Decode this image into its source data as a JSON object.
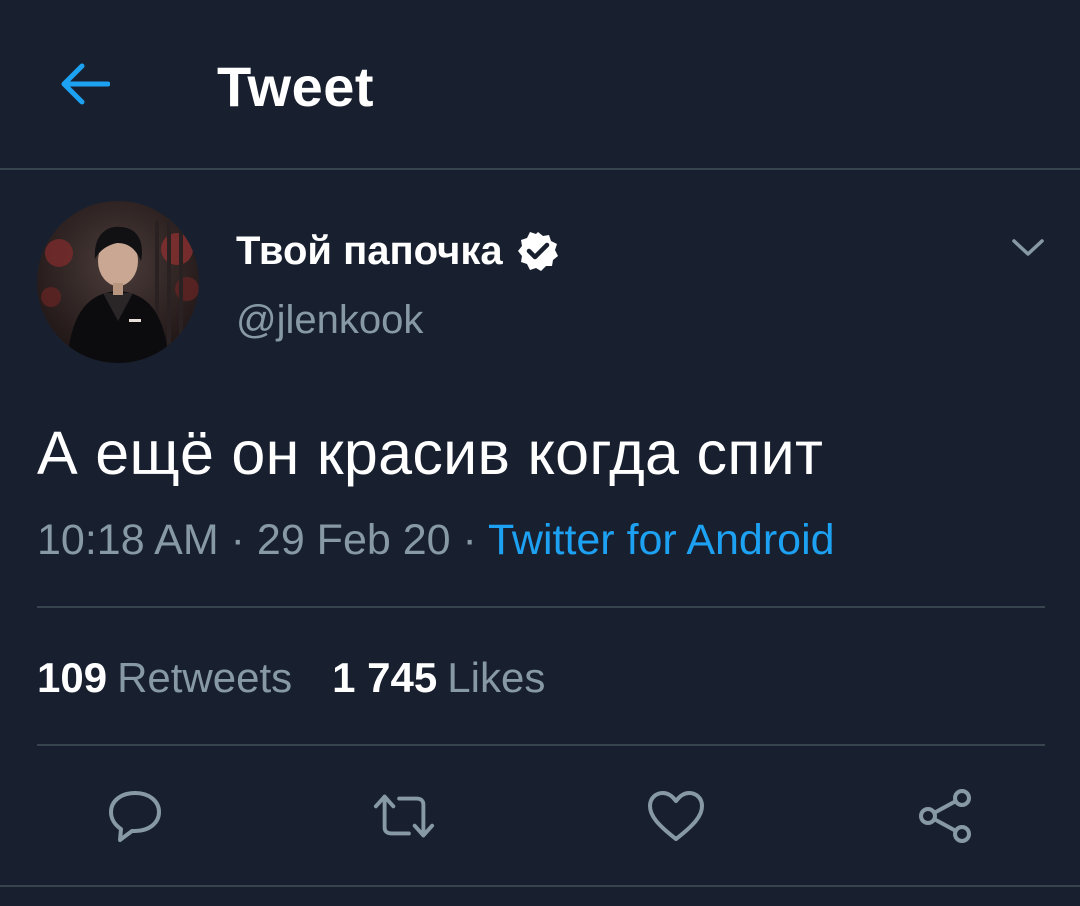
{
  "header": {
    "title": "Tweet",
    "back_icon": "arrow-left-icon",
    "accent": "#1da1f2"
  },
  "author": {
    "display_name": "Твой папочка",
    "handle": "@jlenkook",
    "verified": true,
    "verified_icon": "verified-badge-icon"
  },
  "tweet": {
    "text": "А ещё он красив когда спит",
    "time": "10:18 AM",
    "date": "29 Feb 20",
    "separator": " · ",
    "source": "Twitter for Android"
  },
  "stats": {
    "retweets_count": "109",
    "retweets_label": "Retweets",
    "likes_count": "1 745",
    "likes_label": "Likes"
  },
  "actions": [
    {
      "name": "reply",
      "icon": "comment-icon"
    },
    {
      "name": "retweet",
      "icon": "retweet-icon"
    },
    {
      "name": "like",
      "icon": "heart-icon"
    },
    {
      "name": "share",
      "icon": "share-icon"
    }
  ],
  "colors": {
    "background": "#182030",
    "divider": "#38444d",
    "muted_text": "#8899a6",
    "link": "#1da1f2"
  }
}
